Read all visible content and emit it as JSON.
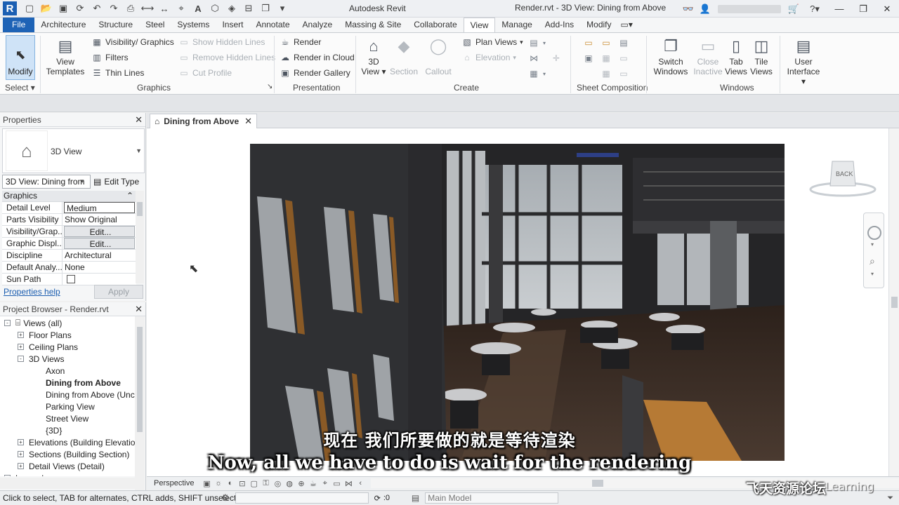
{
  "titlebar": {
    "app_name": "Autodesk Revit",
    "doc_title": "Render.rvt - 3D View: Dining from Above",
    "quick_access_icons": [
      "open-icon",
      "save-icon",
      "sync-icon",
      "undo-icon",
      "redo-icon",
      "print-icon",
      "measure-icon",
      "dimension-icon",
      "tag-icon",
      "text-icon",
      "3d-view-icon",
      "section-icon",
      "close-hidden-icon",
      "switch-windows-icon"
    ],
    "right_icons": [
      "binoculars-icon",
      "user-icon",
      "cart-icon",
      "help-icon"
    ]
  },
  "ribbon_tabs": [
    "File",
    "Architecture",
    "Structure",
    "Steel",
    "Systems",
    "Insert",
    "Annotate",
    "Analyze",
    "Massing & Site",
    "Collaborate",
    "View",
    "Manage",
    "Add-Ins",
    "Modify"
  ],
  "active_tab": "View",
  "ribbon": {
    "select": {
      "modify": "Modify",
      "panel": "Select"
    },
    "graphics": {
      "view_templates": [
        "View",
        "Templates"
      ],
      "visibility_graphics": "Visibility/ Graphics",
      "filters": "Filters",
      "thin_lines": "Thin Lines",
      "show_hidden_lines": "Show Hidden Lines",
      "remove_hidden_lines": "Remove Hidden Lines",
      "cut_profile": "Cut Profile",
      "panel": "Graphics"
    },
    "presentation": {
      "render": "Render",
      "render_in_cloud": "Render in Cloud",
      "render_gallery": "Render Gallery",
      "panel": "Presentation"
    },
    "create": {
      "view_3d": [
        "3D",
        "View"
      ],
      "section": "Section",
      "callout": "Callout",
      "plan_views": "Plan Views",
      "elevation": "Elevation",
      "panel": "Create"
    },
    "sheet_composition": {
      "panel": "Sheet Composition"
    },
    "windows": {
      "switch_windows": [
        "Switch",
        "Windows"
      ],
      "close_inactive": [
        "Close",
        "Inactive"
      ],
      "tab_views": [
        "Tab",
        "Views"
      ],
      "tile_views": [
        "Tile",
        "Views"
      ],
      "panel": "Windows"
    },
    "user_interface": [
      "User",
      "Interface"
    ]
  },
  "properties": {
    "title": "Properties",
    "type_name": "3D View",
    "view_selector": "3D View: Dining from",
    "edit_type": "Edit Type",
    "group": "Graphics",
    "rows": [
      {
        "name": "Detail Level",
        "value": "Medium"
      },
      {
        "name": "Parts Visibility",
        "value": "Show Original"
      },
      {
        "name": "Visibility/Grap...",
        "value": "Edit..."
      },
      {
        "name": "Graphic Displ...",
        "value": "Edit..."
      },
      {
        "name": "Discipline",
        "value": "Architectural"
      },
      {
        "name": "Default Analy...",
        "value": "None"
      },
      {
        "name": "Sun Path",
        "value": ""
      }
    ],
    "help": "Properties help",
    "apply": "Apply"
  },
  "browser": {
    "title": "Project Browser - Render.rvt",
    "items": [
      {
        "label": "Views (all)",
        "level": 0,
        "exp": "-"
      },
      {
        "label": "Floor Plans",
        "level": 1,
        "exp": "+"
      },
      {
        "label": "Ceiling Plans",
        "level": 1,
        "exp": "+"
      },
      {
        "label": "3D Views",
        "level": 1,
        "exp": "-"
      },
      {
        "label": "Axon",
        "level": 2
      },
      {
        "label": "Dining from Above",
        "level": 2,
        "bold": true
      },
      {
        "label": "Dining from Above (Uncr",
        "level": 2
      },
      {
        "label": "Parking View",
        "level": 2
      },
      {
        "label": "Street View",
        "level": 2
      },
      {
        "label": "{3D}",
        "level": 2
      },
      {
        "label": "Elevations (Building Elevation",
        "level": 1,
        "exp": "+"
      },
      {
        "label": "Sections (Building Section)",
        "level": 1,
        "exp": "+"
      },
      {
        "label": "Detail Views (Detail)",
        "level": 1,
        "exp": "+"
      },
      {
        "label": "Legends",
        "level": 0,
        "exp": "+"
      }
    ]
  },
  "view_tab": {
    "label": "Dining from Above"
  },
  "viewcube": {
    "face": "BACK"
  },
  "subtitles": {
    "cn": "现在 我们所要做的就是等待渲染",
    "en": "Now, all we have to do is wait for the rendering"
  },
  "view_control": {
    "label": "Perspective"
  },
  "status": {
    "text": "Click to select, TAB for alternates, CTRL adds, SHIFT unselects.",
    "zero": ":0",
    "model": "Main Model"
  },
  "watermark": {
    "cn": "飞天资源论坛",
    "en": "Learning"
  }
}
